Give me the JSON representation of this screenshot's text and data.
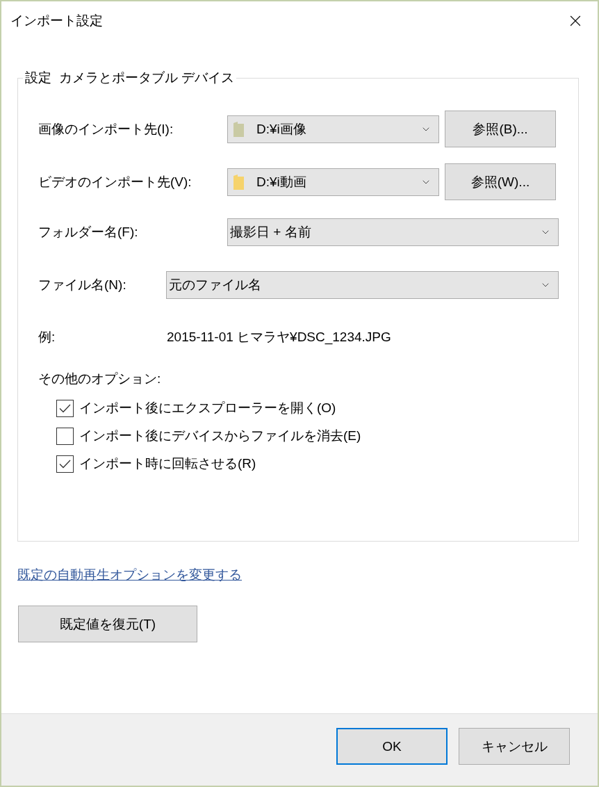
{
  "window": {
    "title": "インポート設定"
  },
  "group": {
    "title": "設定  カメラとポータブル デバイス"
  },
  "fields": [
    {
      "kind": "destination",
      "label": "画像のインポート先(I):",
      "value": "D:¥i画像",
      "color": "#c9caa4",
      "browse": "参照(B)..."
    },
    {
      "kind": "destination",
      "label": "ビデオのインポート先(V):",
      "value": "D:¥i動画",
      "color": "#f6d36c",
      "browse": "参照(W)..."
    },
    {
      "kind": "select",
      "label": "フォルダー名(F):",
      "value": "撮影日 + 名前"
    },
    {
      "kind": "select",
      "label": "ファイル名(N):",
      "value": "元のファイル名"
    }
  ],
  "example": {
    "label": "例:",
    "value": "2015-11-01 ヒマラヤ¥DSC_1234.JPG"
  },
  "options": {
    "label": "その他のオプション:",
    "items": [
      {
        "label": "インポート後にエクスプローラーを開く(O)",
        "checked": true
      },
      {
        "label": "インポート後にデバイスからファイルを消去(E)",
        "checked": false
      },
      {
        "label": "インポート時に回転させる(R)",
        "checked": true
      }
    ]
  },
  "link": "既定の自動再生オプションを変更する",
  "restore_button": "既定値を復元(T)",
  "footer": {
    "buttons": [
      {
        "label": "OK",
        "default": true
      },
      {
        "label": "キャンセル",
        "default": false
      }
    ]
  }
}
